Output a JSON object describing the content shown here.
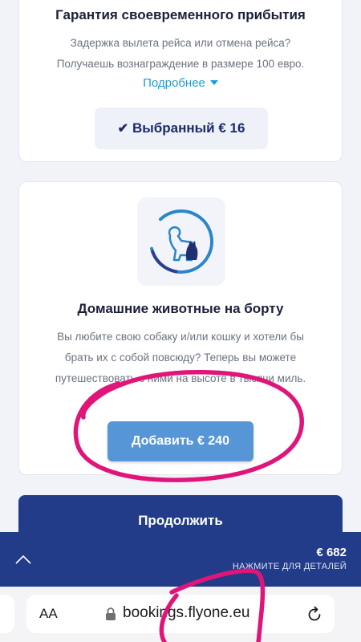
{
  "card_guarantee": {
    "title": "Гарантия своевременного прибытия",
    "description": "Задержка вылета рейса или отмена рейса? Получаешь вознаграждение в размере 100 евро.",
    "more_link": "Подробнее",
    "selected_button": "Выбранный € 16"
  },
  "card_pets": {
    "icon": "pet-dog-cat-icon",
    "title": "Домашние животные на борту",
    "description": "Вы любите свою собаку и/или кошку и хотели бы брать их с собой повсюду? Теперь вы можете путешествовать с ними на высоте в тысячи миль.",
    "add_button": "Добавить € 240"
  },
  "continue_button": "Продолжить",
  "summary": {
    "total": "€ 682",
    "hint": "НАЖМИТЕ ДЛЯ ДЕТАЛЕЙ"
  },
  "browser": {
    "text_size_label": "AA",
    "url": "bookings.flyone.eu"
  },
  "colors": {
    "brand_navy": "#223c8a",
    "add_button_blue": "#5796d6",
    "link_blue": "#1a9bd7",
    "annotation_magenta": "#e0157a"
  }
}
